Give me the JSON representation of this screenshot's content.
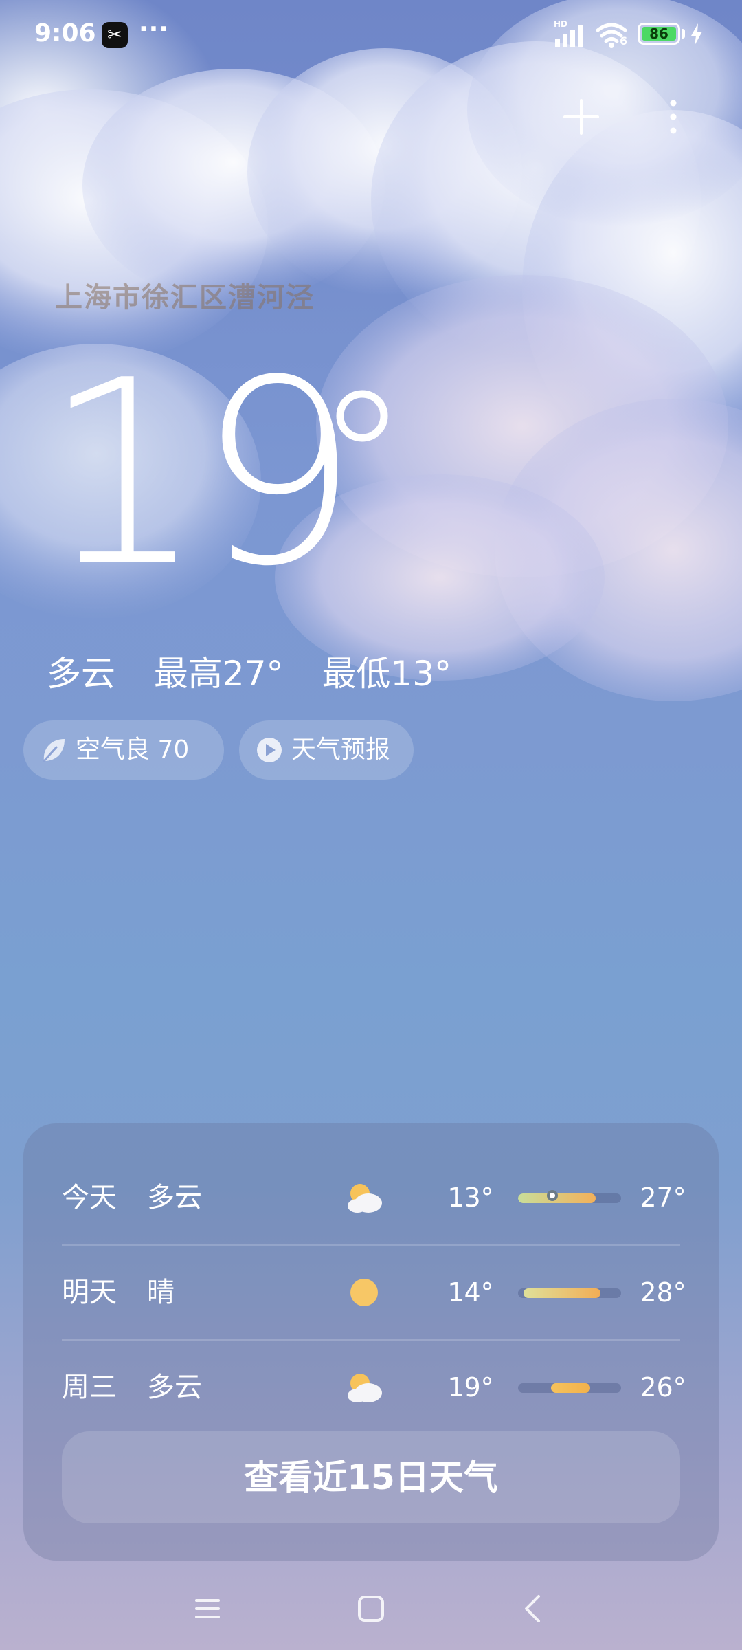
{
  "status_bar": {
    "time": "9:06",
    "app_badge": "✂",
    "dots": "···",
    "hd": "HD",
    "wifi_band": "6",
    "battery": "86",
    "battery_color": "#4cd964"
  },
  "top_actions": {
    "add_icon": "plus-icon",
    "more_icon": "more-vertical-icon"
  },
  "weather": {
    "location": "上海市徐汇区漕河泾",
    "temperature": "19",
    "condition": "多云",
    "high": "最高27°",
    "low": "最低13°"
  },
  "pills": {
    "air_quality": "空气良 70",
    "forecast_video": "天气预报"
  },
  "forecast": {
    "rows": [
      {
        "day": "今天",
        "condition": "多云",
        "icon": "partly-cloudy-icon",
        "low": "13°",
        "high": "27°",
        "range_start": 0.0,
        "range_end": 0.75,
        "now": 0.33
      },
      {
        "day": "明天",
        "condition": "晴",
        "icon": "sun-icon",
        "low": "14°",
        "high": "28°",
        "range_start": 0.05,
        "range_end": 0.8
      },
      {
        "day": "周三",
        "condition": "多云",
        "icon": "partly-cloudy-icon",
        "low": "19°",
        "high": "26°",
        "range_start": 0.32,
        "range_end": 0.7
      }
    ],
    "cta": "查看近15日天气"
  },
  "nav": {
    "menu_icon": "menu-icon",
    "home_icon": "home-square-icon",
    "back_icon": "back-chevron-icon"
  }
}
